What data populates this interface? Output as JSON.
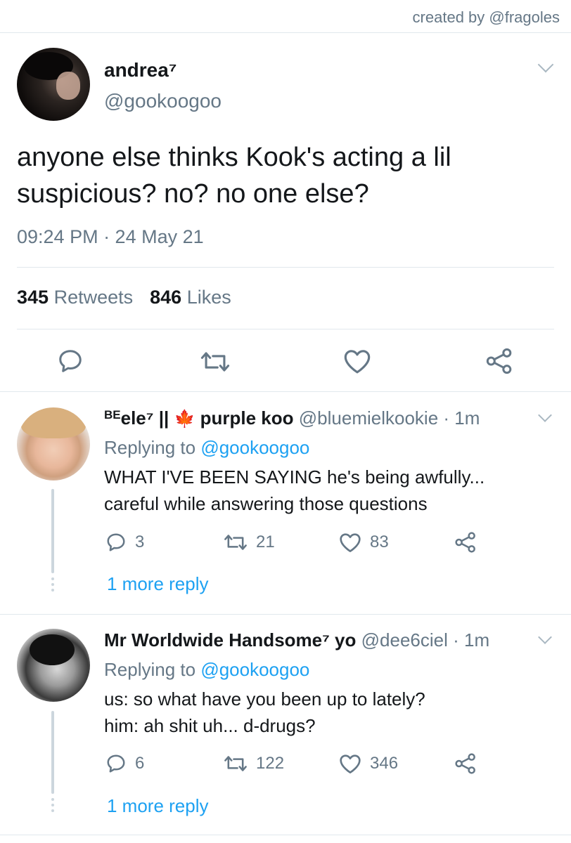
{
  "credit": "created by @fragoles",
  "main_tweet": {
    "name": "andrea⁷",
    "handle": "@gookoogoo",
    "text_line1": "anyone else thinks Kook's acting a lil",
    "text_line2": "suspicious? no? no one else?",
    "timestamp": "09:24 PM · 24 May 21",
    "retweets_count": "345",
    "retweets_label": "Retweets",
    "likes_count": "846",
    "likes_label": "Likes"
  },
  "replies": [
    {
      "name": "BEele⁷ || 🍁 purple koo",
      "name_prefix": "BE",
      "name_rest": "ele⁷ ||",
      "name_emoji": "🍁",
      "name_tail": "purple koo",
      "handle_time": "@bluemielkookie · 1m",
      "replying_label": "Replying to",
      "replying_to": "@gookoogoo",
      "text_line1": "WHAT I'VE BEEN SAYING he's being awfully...",
      "text_line2": "careful while answering those questions",
      "replies": "3",
      "retweets": "21",
      "likes": "83",
      "more_replies": "1 more reply"
    },
    {
      "name": "Mr Worldwide Handsome⁷ yo",
      "handle_time": "@dee6ciel · 1m",
      "replying_label": "Replying to",
      "replying_to": "@gookoogoo",
      "text_line1": "us: so what have you been up to lately?",
      "text_line2": "him: ah shit uh... d-drugs?",
      "replies": "6",
      "retweets": "122",
      "likes": "346",
      "more_replies": "1 more reply"
    }
  ],
  "icons": {
    "reply": "reply-icon",
    "retweet": "retweet-icon",
    "like": "heart-icon",
    "share": "share-icon",
    "menu": "chevron-down-icon"
  },
  "colors": {
    "link": "#1da1f2",
    "secondary_text": "#657786",
    "primary_text": "#14171a",
    "divider": "#e1e8ed"
  }
}
